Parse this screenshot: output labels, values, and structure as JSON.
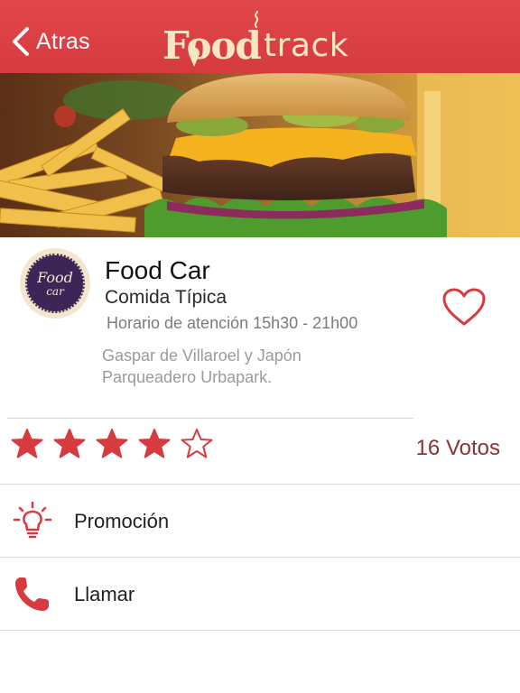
{
  "header": {
    "back_label": "Atras",
    "logo_food": "Food",
    "logo_track": "track",
    "background_color": "#d63b40"
  },
  "restaurant": {
    "avatar_text_1": "Food",
    "avatar_text_2": "car",
    "name": "Food Car",
    "category": "Comida Típica",
    "hours": "Horario de atención 15h30 - 21h00",
    "address_line1": "Gaspar de Villaroel y Japón",
    "address_line2": "Parqueadero Urbapark.",
    "favorite": false
  },
  "rating": {
    "stars_filled": 4,
    "stars_total": 5,
    "votes_label": "16 Votos"
  },
  "actions": {
    "promo_label": "Promoción",
    "call_label": "Llamar"
  },
  "colors": {
    "accent": "#d63b40",
    "dark_accent": "#8b3236",
    "divider": "#d9d9d9"
  }
}
